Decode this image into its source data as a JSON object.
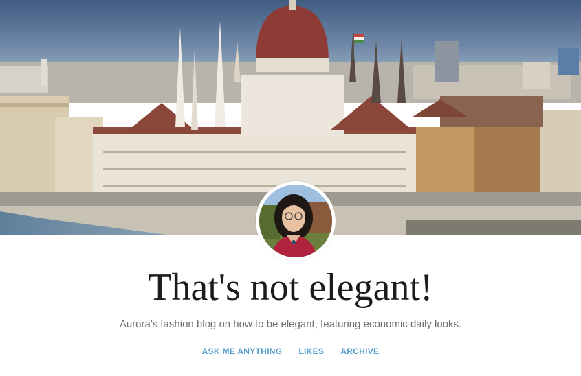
{
  "blog": {
    "title": "That's not elegant!",
    "description": "Aurora's fashion blog on how to be elegant, featuring economic daily looks."
  },
  "nav": {
    "items": [
      {
        "label": "ASK ME ANYTHING"
      },
      {
        "label": "LIKES"
      },
      {
        "label": "ARCHIVE"
      }
    ]
  },
  "colors": {
    "accent": "#529ecc",
    "title": "#1c1c1c",
    "description": "#6f6f6f",
    "background": "#ffffff"
  }
}
